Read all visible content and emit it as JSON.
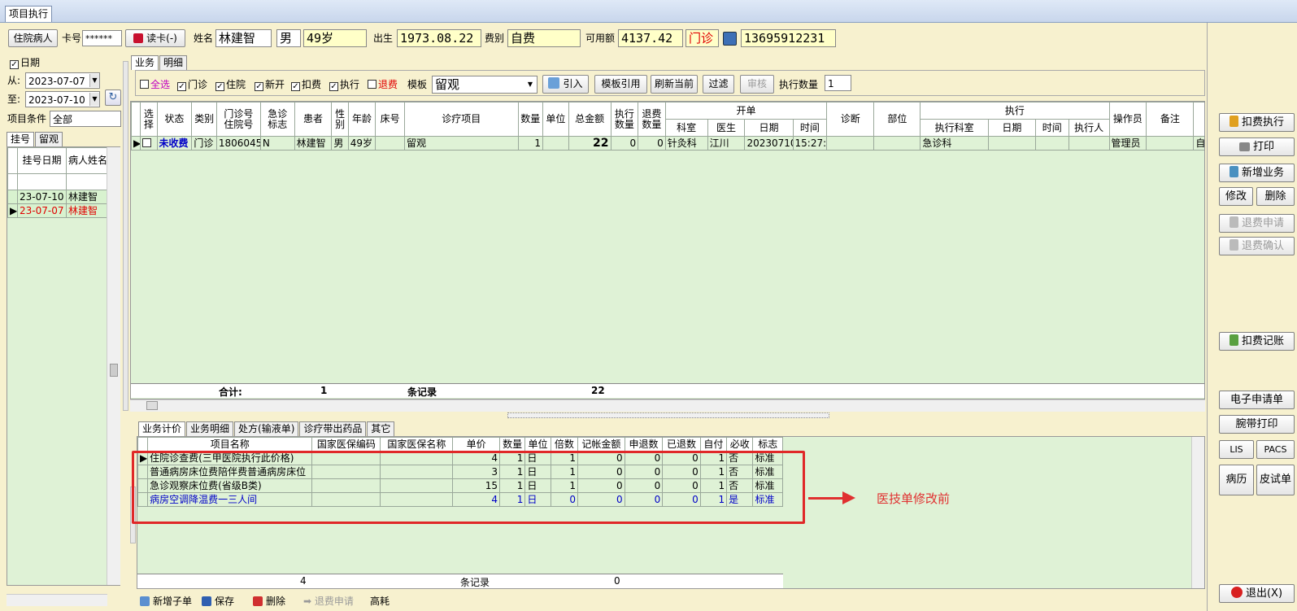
{
  "window": {
    "tab_title": "项目执行"
  },
  "patient_bar": {
    "inpatient_button": "住院病人",
    "card_no_label": "卡号",
    "card_no_value": "******",
    "read_card_button": "读卡(-)",
    "name_label": "姓名",
    "name": "林建智",
    "sex": "男",
    "age": "49岁",
    "birth_label": "出生",
    "birth": "1973.08.22",
    "fee_type_label": "费别",
    "fee_type": "自费",
    "balance_label": "可用额",
    "balance": "4137.42",
    "visit_type": "门诊",
    "phone": "13695912231"
  },
  "left_panel": {
    "date_check": "日期",
    "from_label": "从:",
    "from_date": "2023-07-07",
    "to_label": "至:",
    "to_date": "2023-07-10",
    "item_cond_label": "项目条件",
    "item_cond_value": "全部",
    "tabs": [
      "挂号",
      "留观"
    ],
    "columns": [
      "挂号日期",
      "病人姓名"
    ],
    "rows": [
      {
        "date": "23-07-10",
        "name": "林建智"
      },
      {
        "date": "23-07-07",
        "name": "林建智"
      }
    ]
  },
  "main_tabs": [
    "业务",
    "明细"
  ],
  "filters": {
    "select_all": "全选",
    "outpatient": "门诊",
    "inpatient": "住院",
    "new_open": "新开",
    "deduct": "扣费",
    "execute": "执行",
    "refund": "退费",
    "template_label": "模板",
    "template_value": "留观",
    "import_button": "引入",
    "template_ref_button": "模板引用",
    "refresh_button": "刷新当前",
    "filter_button": "过滤",
    "audit_button": "审核",
    "exec_qty_label": "执行数量",
    "exec_qty_value": "1"
  },
  "upper_grid": {
    "headers": {
      "select": "选择",
      "status": "状态",
      "category": "类别",
      "visit_no": "门诊号\n住院号",
      "urgent": "急诊\n标志",
      "patient": "患者",
      "sex": "性别",
      "age": "年龄",
      "bed": "床号",
      "item": "诊疗项目",
      "qty": "数量",
      "unit": "单位",
      "total": "总金额",
      "exec_qty": "执行\n数量",
      "refund_qty": "退费\n数量",
      "open_group": "开单",
      "dept": "科室",
      "doctor": "医生",
      "date": "日期",
      "time": "时间",
      "diagnosis": "诊断",
      "site": "部位",
      "exec_group": "执行",
      "exec_dept": "执行科室",
      "exec_date": "日期",
      "exec_time": "时间",
      "executor": "执行人",
      "operator": "操作员",
      "remark": "备注"
    },
    "rows": [
      {
        "status": "未收费",
        "category": "门诊",
        "visit_no": "1806045",
        "urgent": "N",
        "patient": "林建智",
        "sex": "男",
        "age": "49岁",
        "bed": "",
        "item": "留观",
        "qty": "1",
        "unit": "",
        "total": "22",
        "exec_qty": "0",
        "refund_qty": "0",
        "dept": "针灸科",
        "doctor": "江川",
        "date": "20230710",
        "time": "15:27:",
        "exec_dept": "急诊科",
        "operator": "管理员",
        "extra": "自"
      }
    ],
    "footer": {
      "sum_label": "合计:",
      "count": "1",
      "records_label": "条记录",
      "total": "22"
    }
  },
  "lower_tabs": [
    "业务计价",
    "业务明细",
    "处方(输液单)",
    "诊疗带出药品",
    "其它"
  ],
  "lower_grid": {
    "headers": [
      "项目名称",
      "国家医保编码",
      "国家医保名称",
      "单价",
      "数量",
      "单位",
      "倍数",
      "记帐金额",
      "申退数",
      "已退数",
      "自付",
      "必收",
      "标志"
    ],
    "rows": [
      [
        "住院诊查费(三甲医院执行此价格)",
        "",
        "",
        "4",
        "1",
        "日",
        "1",
        "0",
        "0",
        "0",
        "1",
        "否",
        "标准"
      ],
      [
        "普通病房床位费陪伴费普通病房床位",
        "",
        "",
        "3",
        "1",
        "日",
        "1",
        "0",
        "0",
        "0",
        "1",
        "否",
        "标准"
      ],
      [
        "急诊观察床位费(省级B类)",
        "",
        "",
        "15",
        "1",
        "日",
        "1",
        "0",
        "0",
        "0",
        "1",
        "否",
        "标准"
      ],
      [
        "病房空调降温费一三人间",
        "",
        "",
        "4",
        "1",
        "日",
        "0",
        "0",
        "0",
        "0",
        "1",
        "是",
        "标准"
      ]
    ],
    "footer": {
      "count": "4",
      "records_label": "条记录",
      "amount": "0"
    }
  },
  "annotation": {
    "text": "医技单修改前",
    "color": "#e03030"
  },
  "bottom_toolbar": {
    "add_child": "新增子单",
    "save": "保存",
    "delete": "删除",
    "refund_apply": "退费申请",
    "high_consume": "高耗"
  },
  "right_buttons": {
    "deduct_execute": "扣费执行",
    "print": "打印",
    "new_business": "新增业务",
    "modify": "修改",
    "delete": "删除",
    "refund_apply": "退费申请",
    "refund_confirm": "退费确认",
    "deduct_record": "扣费记账",
    "e_apply": "电子申请单",
    "wristband": "腕带打印",
    "lis": "LIS",
    "pacs": "PACS",
    "medical_record": "病历",
    "skin_test": "皮试单",
    "exit": "退出(X)"
  }
}
